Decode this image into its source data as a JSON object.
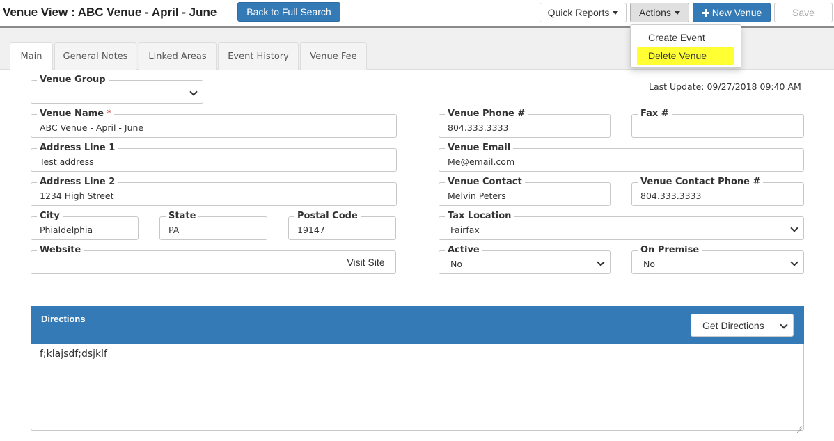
{
  "header": {
    "title": "Venue View : ABC Venue - April - June",
    "back_button": "Back to Full Search",
    "quick_reports": "Quick Reports",
    "actions": "Actions",
    "new_venue": "New Venue",
    "save": "Save"
  },
  "actions_menu": {
    "items": [
      "Create Event",
      "Delete Venue"
    ],
    "highlighted": "Delete Venue",
    "highlight_color": "#ffff33"
  },
  "tabs": [
    {
      "label": "Main",
      "active": true
    },
    {
      "label": "General Notes",
      "active": false
    },
    {
      "label": "Linked Areas",
      "active": false
    },
    {
      "label": "Event History",
      "active": false
    },
    {
      "label": "Venue Fee",
      "active": false
    }
  ],
  "last_update": "Last Update: 09/27/2018 09:40 AM",
  "form": {
    "venue_group": {
      "label": "Venue Group",
      "value": ""
    },
    "venue_name": {
      "label": "Venue Name",
      "required_mark": "*",
      "value": "ABC Venue - April - June"
    },
    "address1": {
      "label": "Address Line 1",
      "value": "Test address"
    },
    "address2": {
      "label": "Address Line 2",
      "value": "1234 High Street"
    },
    "city": {
      "label": "City",
      "value": "Phialdelphia"
    },
    "state": {
      "label": "State",
      "value": "PA"
    },
    "postal": {
      "label": "Postal Code",
      "value": "19147"
    },
    "website": {
      "label": "Website",
      "value": "",
      "button": "Visit Site"
    },
    "phone": {
      "label": "Venue Phone #",
      "value": "804.333.3333"
    },
    "fax": {
      "label": "Fax #",
      "value": ""
    },
    "email": {
      "label": "Venue Email",
      "value": "Me@email.com"
    },
    "contact": {
      "label": "Venue Contact",
      "value": "Melvin Peters"
    },
    "contact_phone": {
      "label": "Venue Contact Phone #",
      "value": "804.333.3333"
    },
    "tax_location": {
      "label": "Tax Location",
      "value": "Fairfax"
    },
    "active": {
      "label": "Active",
      "value": "No"
    },
    "on_premise": {
      "label": "On Premise",
      "value": "No"
    }
  },
  "directions": {
    "label": "Directions",
    "button": "Get Directions",
    "text": "f;klajsdf;dsjklf"
  },
  "colors": {
    "primary": "#337ab7",
    "required": "#c9302c"
  }
}
